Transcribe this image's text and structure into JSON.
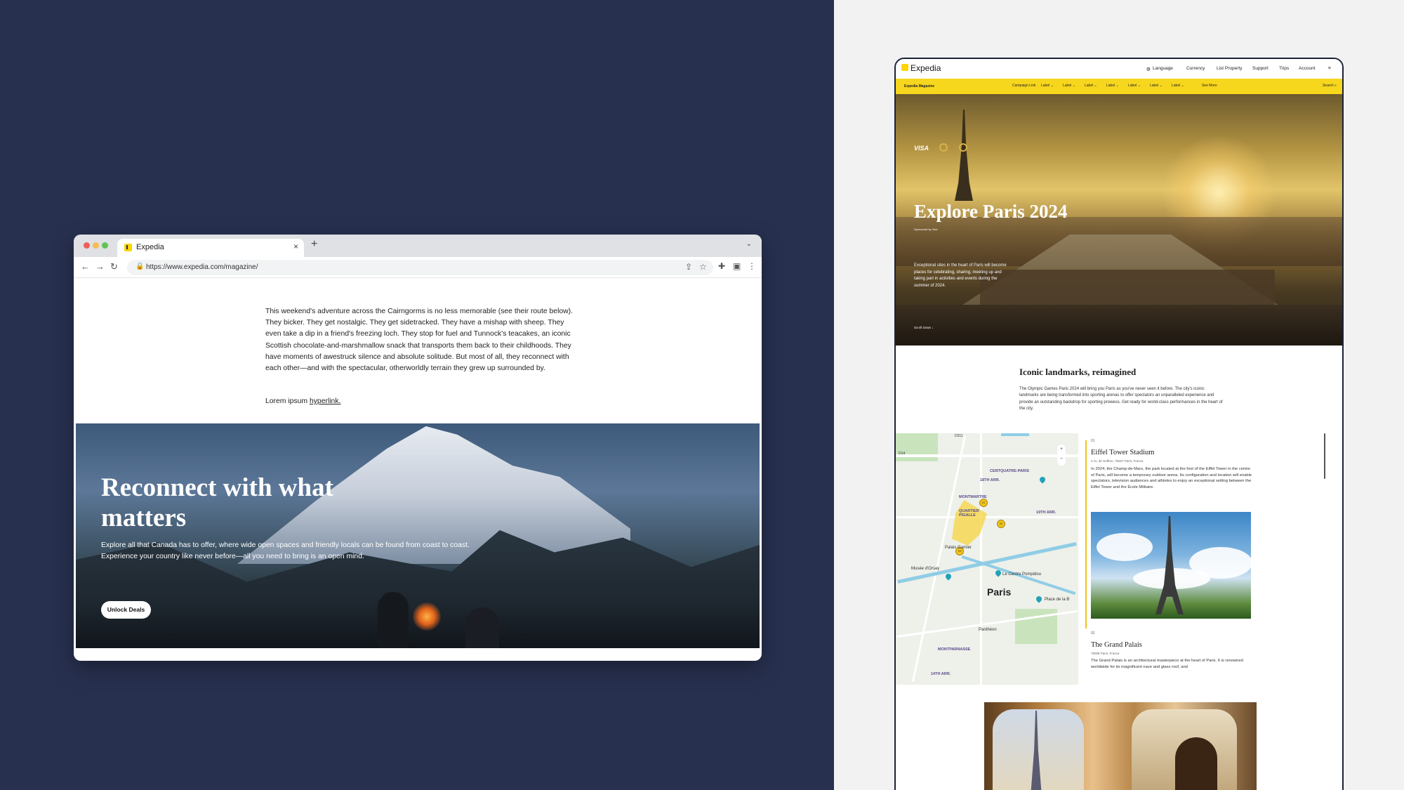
{
  "browser": {
    "tab_title": "Expedia",
    "url": "https://www.expedia.com/magazine/",
    "icons": [
      "close-icon",
      "plus-icon",
      "chevron-down-icon",
      "back-icon",
      "forward-icon",
      "reload-icon",
      "lock-icon",
      "share-icon",
      "star-icon",
      "extensions-icon",
      "sidebar-icon",
      "menu-icon"
    ]
  },
  "article": {
    "paragraph": "This weekend's adventure across the Cairngorms is no less memorable (see their route below). They bicker. They get nostalgic. They get sidetracked. They have a mishap with sheep. They even take a dip in a friend's freezing loch. They stop for fuel and Tunnock's teacakes, an iconic Scottish chocolate-and-marshmallow snack that transports them back to their childhoods. They have moments of awestruck silence and absolute solitude. But most of all, they reconnect with each other—and with the spectacular, otherworldly terrain they grew up surrounded by.",
    "link_prefix": "Lorem ipsum ",
    "link_text": "hyperlink."
  },
  "hero": {
    "title": "Reconnect with what matters",
    "description": "Explore all that Canada has to offer, where wide open spaces and friendly locals can be found from coast to coast. Experience your country like never before—all you need to bring is an open mind.",
    "button": "Unlock Deals"
  },
  "preview": {
    "logo": "Expedia",
    "nav": [
      "Language",
      "Currency",
      "List Property",
      "Support",
      "Trips",
      "Account"
    ],
    "menu_icon": "hamburger-icon",
    "yellow_bar": {
      "brand": "Expedia Magazine",
      "items": [
        "Campaign Link",
        "Label ⌄",
        "Label ⌄",
        "Label ⌄",
        "Label ⌄",
        "Label ⌄",
        "Label ⌄",
        "Label ⌄",
        "See More"
      ],
      "search": "Search ⌕"
    },
    "paris": {
      "visa": "VISA",
      "title": "Explore Paris 2024",
      "sponsor": "Sponsored by Visa",
      "description": "Exceptional sites in the heart of Paris will become places for celebrating, sharing, meeting up and taking part in activities and events during the summer of 2024.",
      "scroll": "Scroll Down ↓"
    },
    "landmarks": {
      "title": "Iconic landmarks, reimagined",
      "description": "The Olympic Games Paris 2024 will bring you Paris as you've never seen it before. The city's iconic landmarks are being transformed into sporting arenas to offer spectators an unparalleled experience and provide an outstanding backdrop for sporting prowess. Get ready for world-class performances in the heart of the city."
    },
    "map": {
      "city": "Paris",
      "labels": [
        "CENTQUATRE-PARIS",
        "18TH ARR.",
        "MONTMARTRE",
        "QUARTIER PIGALLE",
        "19TH ARR.",
        "Palais Garnier",
        "Musée d'Orsay",
        "Le Centre Pompidou",
        "Place de la B",
        "Panthéon",
        "MONTPARNASSE",
        "14TH ARR.",
        "D311",
        "D14"
      ],
      "pins": [
        "01",
        "02",
        "03"
      ],
      "zoom": [
        "+",
        "−"
      ]
    },
    "cards": [
      {
        "num": "01",
        "title": "Eiffel Tower Stadium",
        "address": "2 Av. de Suffren, 75007 Paris, France",
        "description": "In 2024, the Champ-de-Mars, the park located at the foot of the Eiffel Tower in the centre of Paris, will become a temporary outdoor arena. Its configuration and location will enable spectators, television audiences and athletes to enjoy an exceptional setting between the Eiffel Tower and the École Militaire."
      },
      {
        "num": "02",
        "title": "The Grand Palais",
        "address": "75008 Paris, France",
        "description": "The Grand Palais is an architectural masterpiece at the heart of Paris. It is renowned worldwide for its magnificent nave and glass roof, and"
      }
    ]
  },
  "colors": {
    "left_bg": "#27304f",
    "right_bg": "#f2f2f3",
    "expedia_yellow": "#f7d61e",
    "brand_navy": "#1a2a5a"
  }
}
